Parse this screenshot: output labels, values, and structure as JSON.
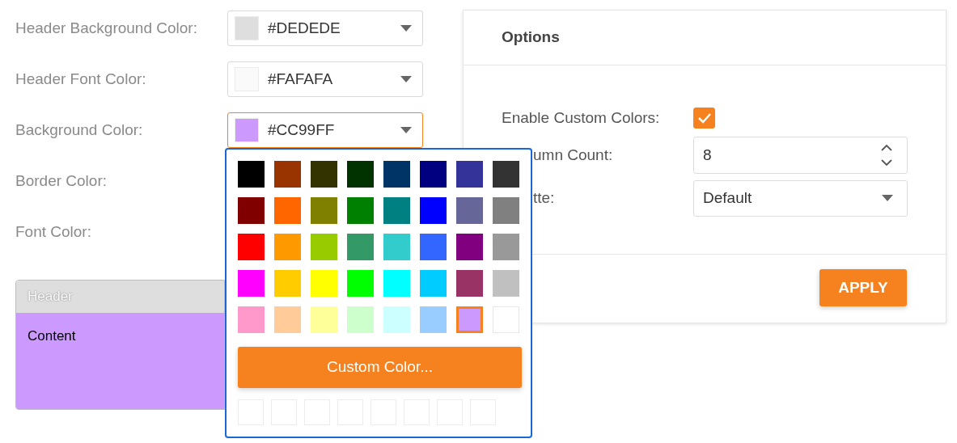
{
  "fields": [
    {
      "label": "Header Background Color:",
      "value": "#DEDEDE",
      "color": "#dedede",
      "focused": false
    },
    {
      "label": "Header Font Color:",
      "value": "#FAFAFA",
      "color": "#fafafa",
      "focused": false
    },
    {
      "label": "Background Color:",
      "value": "#CC99FF",
      "color": "#cc99ff",
      "focused": true
    },
    {
      "label": "Border Color:"
    },
    {
      "label": "Font Color:"
    }
  ],
  "preview": {
    "header": "Header",
    "content": "Content"
  },
  "popup": {
    "swatches": [
      {
        "color": "#000000",
        "selected": false
      },
      {
        "color": "#993300",
        "selected": false
      },
      {
        "color": "#333300",
        "selected": false
      },
      {
        "color": "#003300",
        "selected": false
      },
      {
        "color": "#003366",
        "selected": false
      },
      {
        "color": "#000080",
        "selected": false
      },
      {
        "color": "#333399",
        "selected": false
      },
      {
        "color": "#333333",
        "selected": false
      },
      {
        "color": "#800000",
        "selected": false
      },
      {
        "color": "#ff6600",
        "selected": false
      },
      {
        "color": "#808000",
        "selected": false
      },
      {
        "color": "#008000",
        "selected": false
      },
      {
        "color": "#008080",
        "selected": false
      },
      {
        "color": "#0000ff",
        "selected": false
      },
      {
        "color": "#666699",
        "selected": false
      },
      {
        "color": "#808080",
        "selected": false
      },
      {
        "color": "#ff0000",
        "selected": false
      },
      {
        "color": "#ff9900",
        "selected": false
      },
      {
        "color": "#99cc00",
        "selected": false
      },
      {
        "color": "#339966",
        "selected": false
      },
      {
        "color": "#33cccc",
        "selected": false
      },
      {
        "color": "#3366ff",
        "selected": false
      },
      {
        "color": "#800080",
        "selected": false
      },
      {
        "color": "#999999",
        "selected": false
      },
      {
        "color": "#ff00ff",
        "selected": false
      },
      {
        "color": "#ffcc00",
        "selected": false
      },
      {
        "color": "#ffff00",
        "selected": false
      },
      {
        "color": "#00ff00",
        "selected": false
      },
      {
        "color": "#00ffff",
        "selected": false
      },
      {
        "color": "#00ccff",
        "selected": false
      },
      {
        "color": "#993366",
        "selected": false
      },
      {
        "color": "#c0c0c0",
        "selected": false
      },
      {
        "color": "#ff99cc",
        "selected": false
      },
      {
        "color": "#ffcc99",
        "selected": false
      },
      {
        "color": "#ffff99",
        "selected": false
      },
      {
        "color": "#ccffcc",
        "selected": false
      },
      {
        "color": "#ccffff",
        "selected": false
      },
      {
        "color": "#99ccff",
        "selected": false
      },
      {
        "color": "#cc99ff",
        "selected": true
      },
      {
        "color": "#ffffff",
        "selected": false
      }
    ],
    "custom_button": "Custom Color...",
    "recent": [
      {
        "empty": true
      },
      {
        "empty": true
      },
      {
        "empty": true
      },
      {
        "empty": true
      },
      {
        "empty": true
      },
      {
        "empty": true
      },
      {
        "empty": true
      },
      {
        "empty": true
      }
    ]
  },
  "options": {
    "title": "Options",
    "rows": [
      {
        "kind": "checkbox",
        "label": "Enable Custom Colors:",
        "checked": true,
        "covered": false
      },
      {
        "kind": "numeric",
        "label": "umn Count:",
        "value": "8",
        "covered": true
      },
      {
        "kind": "dropdown",
        "label": "tte:",
        "value": "Default",
        "covered": true
      }
    ],
    "apply": "APPLY"
  }
}
